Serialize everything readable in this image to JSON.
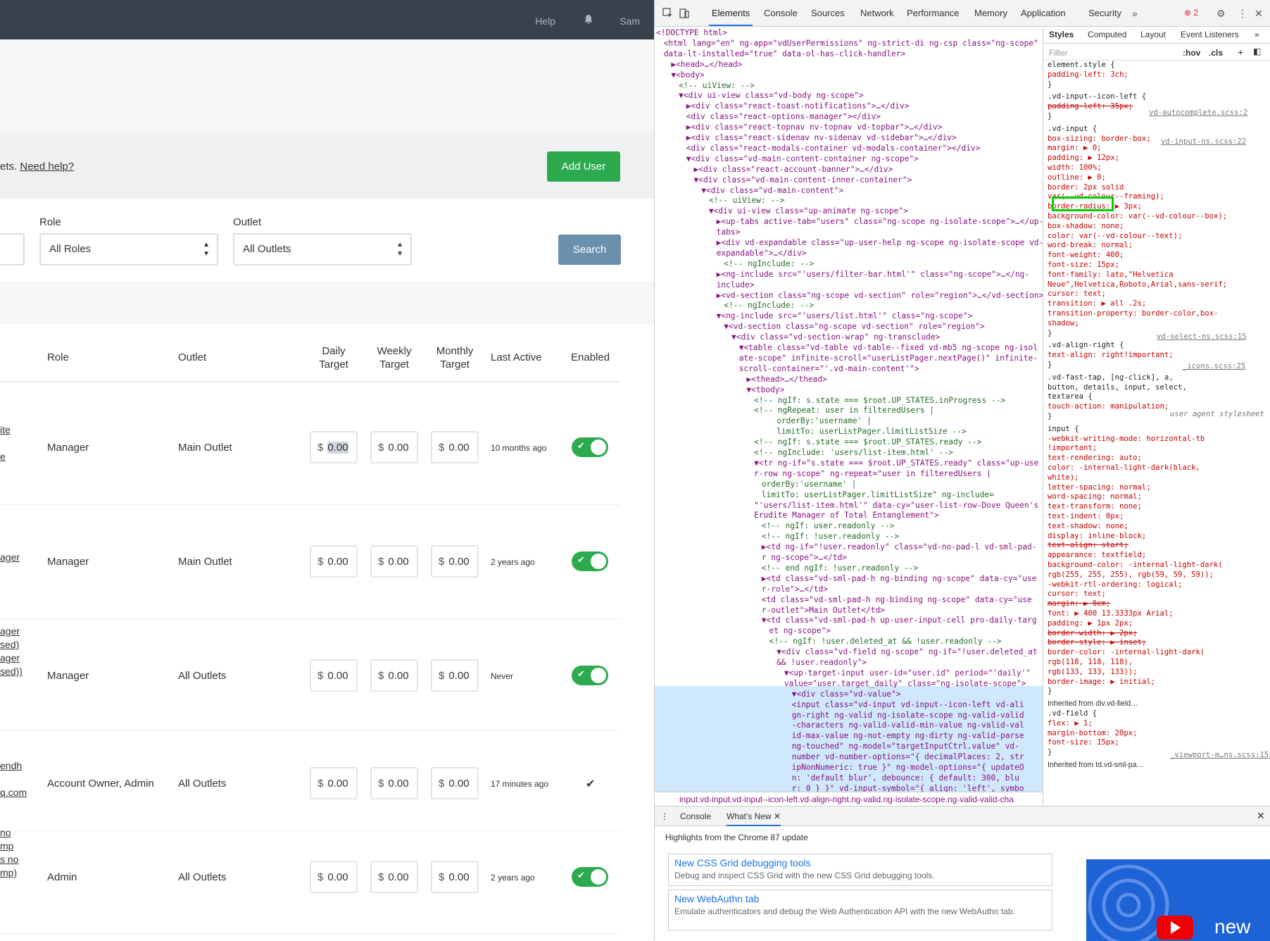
{
  "app": {
    "topbar": {
      "help": "Help",
      "user": "Sam"
    },
    "helpbar": {
      "text": "ets.",
      "link": "Need help?",
      "add_user": "Add User"
    },
    "filters": {
      "role_label": "Role",
      "role_value": "All Roles",
      "outlet_label": "Outlet",
      "outlet_value": "All Outlets",
      "search": "Search"
    },
    "table": {
      "headers": {
        "role": "Role",
        "outlet": "Outlet",
        "daily1": "Daily",
        "daily2": "Target",
        "weekly1": "Weekly",
        "weekly2": "Target",
        "monthly1": "Monthly",
        "monthly2": "Target",
        "last_active": "Last Active",
        "enabled": "Enabled"
      },
      "currency": "$",
      "rows": [
        {
          "name_lines": [
            "ite",
            "e"
          ],
          "role": "Manager",
          "outlet": "Main Outlet",
          "daily": "0.00",
          "weekly": "0.00",
          "monthly": "0.00",
          "last_active": "10 months ago",
          "enabled": "toggle"
        },
        {
          "name_lines": [
            "ager"
          ],
          "role": "Manager",
          "outlet": "Main Outlet",
          "daily": "0.00",
          "weekly": "0.00",
          "monthly": "0.00",
          "last_active": "2 years ago",
          "enabled": "toggle"
        },
        {
          "name_lines": [
            "ager",
            "sed)",
            "ager",
            "sed))"
          ],
          "role": "Manager",
          "outlet": "All Outlets",
          "daily": "0.00",
          "weekly": "0.00",
          "monthly": "0.00",
          "last_active": "Never",
          "enabled": "toggle"
        },
        {
          "name_lines": [
            "endh",
            "q.com"
          ],
          "role": "Account Owner, Admin",
          "outlet": "All Outlets",
          "daily": "0.00",
          "weekly": "0.00",
          "monthly": "0.00",
          "last_active": "17 minutes ago",
          "enabled": "check"
        },
        {
          "name_lines": [
            "no",
            "mp",
            "s no",
            "mp)"
          ],
          "role": "Admin",
          "outlet": "All Outlets",
          "daily": "0.00",
          "weekly": "0.00",
          "monthly": "0.00",
          "last_active": "2 years ago",
          "enabled": "toggle"
        }
      ]
    }
  },
  "devtools": {
    "tabs": [
      "Elements",
      "Console",
      "Sources",
      "Network",
      "Performance",
      "Memory",
      "Application",
      "Security"
    ],
    "error_count": "2",
    "elements_lines": [
      "<!DOCTYPE html>",
      "<html lang=\"en\" ng-app=\"vdUserPermissions\" ng-strict-di ng-csp class=\"ng-scope\"",
      "data-lt-installed=\"true\" data-ol-has-click-handler>",
      "▶<head>…</head>",
      "▼<body>",
      "<!-- uiView: -->",
      "▼<div ui-view class=\"vd-body ng-scope\">",
      "▶<div class=\"react-toast-notifications\">…</div>",
      "<div class=\"react-options-manager\"></div>",
      "▶<div class=\"react-topnav nv-topnav vd-topbar\">…</div>",
      "▶<div class=\"react-sidenav nv-sidenav vd-sidebar\">…</div>",
      "<div class=\"react-modals-container vd-modals-container\"></div>",
      "▼<div class=\"vd-main-content-container ng-scope\">",
      "▶<div class=\"react-account-banner\">…</div>",
      "▼<div class=\"vd-main-content-inner-container\">",
      "▼<div class=\"vd-main-content\">",
      "<!-- uiView: -->",
      "▼<div ui-view class=\"up-animate ng-scope\">",
      "▶<up-tabs active-tab=\"users\" class=\"ng-scope ng-isolate-scope\">…</up-",
      "tabs>",
      "▶<div vd-expandable class=\"up-user-help ng-scope ng-isolate-scope vd-",
      "expandable\">…</div>",
      "<!-- ngInclude: -->",
      "▶<ng-include src=\"'users/filter-bar.html'\" class=\"ng-scope\">…</ng-",
      "include>",
      "▶<vd-section class=\"ng-scope vd-section\" role=\"region\">…</vd-section>",
      "<!-- ngInclude: -->",
      "▼<ng-include src=\"'users/list.html'\" class=\"ng-scope\">",
      "▼<vd-section class=\"ng-scope vd-section\" role=\"region\">",
      "▼<div class=\"vd-section-wrap\" ng-transclude>",
      "▼<table class=\"vd-table vd-table--fixed vd-mb5 ng-scope ng-isol",
      "ate-scope\" infinite-scroll=\"userListPager.nextPage()\" infinite-",
      "scroll-container=\"'.vd-main-content'\">",
      "▶<thead>…</thead>",
      "▼<tbody>",
      "<!-- ngIf: s.state === $root.UP_STATES.inProgress -->",
      "<!-- ngRepeat: user in filteredUsers |",
      "orderBy:'username' |",
      "limitTo: userListPager.limitListSize -->",
      "<!-- ngIf: s.state === $root.UP_STATES.ready -->",
      "<!-- ngInclude: 'users/list-item.html' -->",
      "▼<tr ng-if=\"s.state === $root.UP_STATES.ready\" class=\"up-use",
      "r-row ng-scope\" ng-repeat=\"user in filteredUsers |",
      "orderBy:'username' |",
      "limitTo: userListPager.limitListSize\" ng-include=",
      "\"'users/list-item.html'\" data-cy=\"user-list-row-Dove Queen's",
      "Erudite Manager of Total Entanglement\">",
      "<!-- ngIf: user.readonly -->",
      "<!-- ngIf: !user.readonly -->",
      "▶<td ng-if=\"!user.readonly\" class=\"vd-no-pad-l vd-sml-pad-",
      "r ng-scope\">…</td>",
      "<!-- end ngIf: !user.readonly -->",
      "▶<td class=\"vd-sml-pad-h ng-binding ng-scope\" data-cy=\"use",
      "r-role\">…</td>",
      "<td class=\"vd-sml-pad-h ng-binding ng-scope\" data-cy=\"use",
      "r-outlet\">Main Outlet</td>",
      "▼<td class=\"vd-sml-pad-h up-user-input-cell pro-daily-targ",
      "et ng-scope\">",
      "<!-- ngIf: !user.deleted_at && !user.readonly -->",
      "▼<div class=\"vd-field ng-scope\" ng-if=\"!user.deleted_at",
      "&& !user.readonly\">",
      "▼<up-target-input user-id=\"user.id\" period=\"'daily'\"",
      "value=\"user.target_daily\" class=\"ng-isolate-scope\">",
      "▼<div class=\"vd-value\">",
      "<input class=\"vd-input vd-input--icon-left vd-ali",
      "gn-right ng-valid ng-isolate-scope ng-valid-valid",
      "-characters ng-valid-valid-min-value ng-valid-val",
      "id-max-value ng-not-empty ng-dirty ng-valid-parse",
      "ng-touched\" ng-model=\"targetInputCtrl.value\" vd-",
      "number vd-number-options=\"{ decimalPlaces: 2, str",
      "ipNonNumeric: true }\" ng-model-options=\"{ updateO",
      "n: 'default blur', debounce: { default: 300, blu",
      "r: 0 } }\" vd-input-symbol=\"{ align: 'left', symbo",
      "l: targetInputCtrl.currencySymbol }\" data-cy=\"tar"
    ],
    "breadcrumb": "input.vd-input.vd-input--icon-left.vd-align-right.ng-valid.ng-isolate-scope.ng-valid-valid-cha",
    "side_tabs": [
      "Styles",
      "Computed",
      "Layout",
      "Event Listeners"
    ],
    "filter_placeholder": "Filter",
    "hov": ":hov",
    "cls": ".cls",
    "styles_lines": [
      "element.style {",
      "  padding-left: 3ch;",
      "}",
      ".vd-input--icon-left {",
      "  padding-left: 35px;",
      "}",
      ".vd-input {",
      "  box-sizing: border-box;",
      "  margin: ▶ 0;",
      "  padding: ▶ 12px;",
      "  width: 100%;",
      "  outline: ▶ 0;",
      "  border: 2px solid",
      "    var(--vd-colour--framing);",
      "  border-radius: ▶ 3px;",
      "  background-color: var(--vd-colour--box);",
      "  box-shadow: none;",
      "  color: var(--vd-colour--text);",
      "  word-break: normal;",
      "  font-weight: 400;",
      "  font-size: 15px;",
      "  font-family: lato,\"Helvetica",
      "    Neue\",Helvetica,Roboto,Arial,sans-serif;",
      "  cursor: text;",
      "  transition: ▶ all .2s;",
      "  transition-property: border-color,box-",
      "    shadow;",
      "}",
      ".vd-align-right {",
      "  text-align: right!important;",
      "}",
      ".vd-fast-tap, [ng-click], a,",
      "button, details, input, select,",
      "textarea {",
      "  touch-action: manipulation;",
      "}",
      "input {",
      "  -webkit-writing-mode: horizontal-tb",
      "    !important;",
      "  text-rendering: auto;",
      "  color: -internal-light-dark(black,",
      "    white);",
      "  letter-spacing: normal;",
      "  word-spacing: normal;",
      "  text-transform: none;",
      "  text-indent: 0px;",
      "  text-shadow: none;",
      "  display: inline-block;",
      "  text-align: start;",
      "  appearance: textfield;",
      "  background-color: -internal-light-dark(",
      "    rgb(255, 255, 255), rgb(59, 59, 59));",
      "  -webkit-rtl-ordering: logical;",
      "  cursor: text;",
      "  margin: ▶ 0em;",
      "  font: ▶ 400 13.3333px Arial;",
      "  padding: ▶ 1px 2px;",
      "  border-width: ▶ 2px;",
      "  border-style: ▶ inset;",
      "  border-color: -internal-light-dark(",
      "    rgb(118, 118, 118),",
      "    rgb(133, 133, 133));",
      "  border-image: ▶ initial;",
      "}",
      "Inherited from div.vd-field…",
      ".vd-field {",
      "  flex: ▶ 1;",
      "  margin-bottom: 20px;",
      "  font-size: 15px;",
      "}",
      "Inherited from td.vd-sml-pa…"
    ],
    "style_sources": {
      "r1": "vd-autocomplete.scss:2",
      "r2": "vd-input-ns.scss:22",
      "r3": "vd-select-ns.scss:15",
      "r4": "_icons.scss:25",
      "r5": "user agent stylesheet",
      "r6": "_viewport-m…ns.scss:153"
    },
    "drawer": {
      "tabs": [
        "Console",
        "What's New"
      ],
      "heading": "Highlights from the Chrome 87 update",
      "cards": [
        {
          "title": "New CSS Grid debugging tools",
          "desc": "Debug and inspect CSS Grid with the new CSS Grid debugging tools."
        },
        {
          "title": "New WebAuthn tab",
          "desc": "Emulate authenticators and debug the Web Authentication API with the new WebAuthn tab."
        }
      ],
      "thumb_text": "new"
    }
  }
}
